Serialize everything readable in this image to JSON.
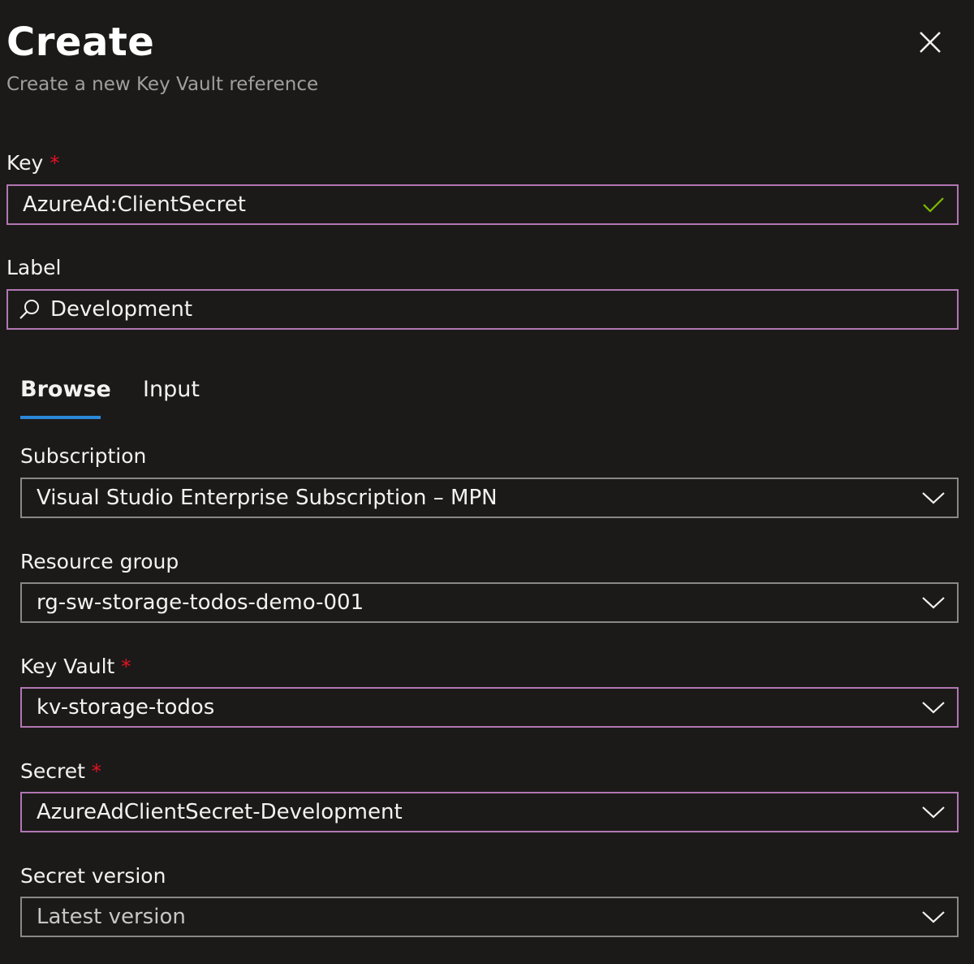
{
  "header": {
    "title": "Create",
    "subtitle": "Create a new Key Vault reference"
  },
  "key": {
    "label": "Key",
    "required_mark": "*",
    "value": "AzureAd:ClientSecret",
    "status_icon": "checkmark-icon"
  },
  "label_field": {
    "label": "Label",
    "value": "Development",
    "icon": "search-icon"
  },
  "tabs": [
    {
      "label": "Browse",
      "active": true
    },
    {
      "label": "Input",
      "active": false
    }
  ],
  "subscription": {
    "label": "Subscription",
    "value": "Visual Studio Enterprise Subscription – MPN"
  },
  "resource_group": {
    "label": "Resource group",
    "value": "rg-sw-storage-todos-demo-001"
  },
  "key_vault": {
    "label": "Key Vault",
    "required_mark": "*",
    "value": "kv-storage-todos"
  },
  "secret": {
    "label": "Secret",
    "required_mark": "*",
    "value": "AzureAdClientSecret-Development"
  },
  "secret_version": {
    "label": "Secret version",
    "value": "Latest version"
  },
  "colors": {
    "background": "#1b1a19",
    "focus_border": "#b276b2",
    "border": "#8a8886",
    "required": "#e81123",
    "success": "#7fba00",
    "tab_accent": "#2b88d8"
  }
}
